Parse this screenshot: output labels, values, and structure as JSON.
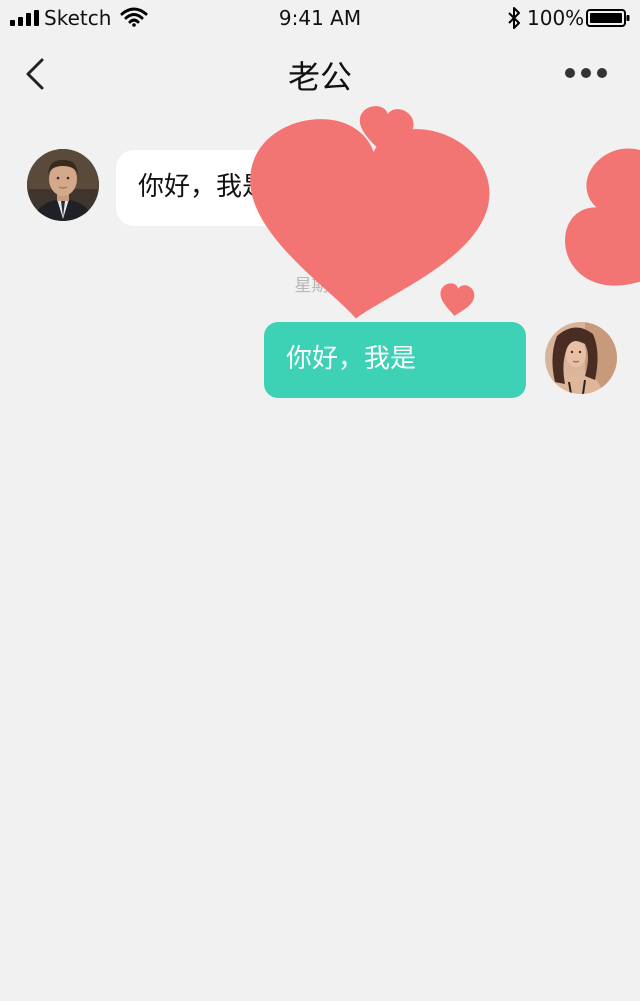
{
  "status_bar": {
    "carrier": "Sketch",
    "time": "9:41 AM",
    "battery": "100%",
    "icons": [
      "signal-icon",
      "wifi-icon",
      "bluetooth-icon",
      "battery-icon"
    ]
  },
  "nav": {
    "title": "老公",
    "back_icon": "chevron-left-icon",
    "more_icon": "more-horizontal-icon"
  },
  "messages": [
    {
      "side": "incoming",
      "sender": "老公",
      "text": "你好，我是"
    },
    {
      "side": "outgoing",
      "text": "你好，我是"
    }
  ],
  "timestamp": "星期六",
  "colors": {
    "background": "#f2f1f1",
    "incoming_bubble": "#ffffff",
    "outgoing_bubble": "#3dd1b5",
    "heart_sticker": "#f27574"
  }
}
